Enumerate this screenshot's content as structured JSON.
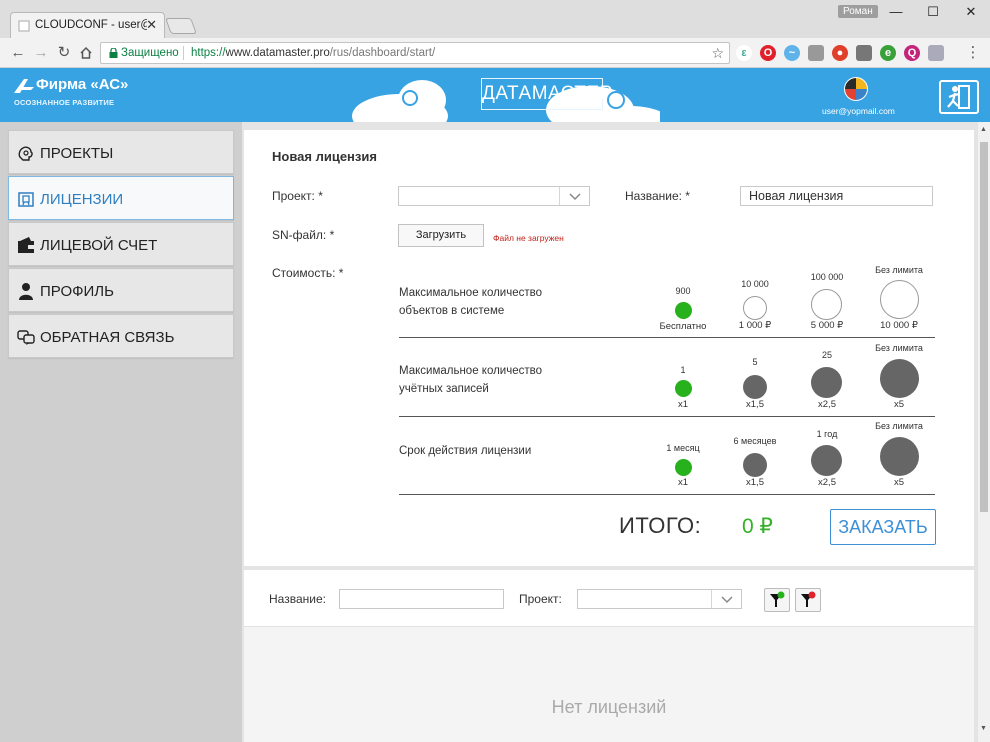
{
  "browser": {
    "tab_title": "CLOUDCONF - user@yop",
    "tab_close": "✕",
    "profile_name": "Роман",
    "window_controls": {
      "minimize": "—",
      "maximize": "☐",
      "close": "✕"
    },
    "secure_label": "Защищено",
    "url_scheme": "https://",
    "url_host": "www.datamaster.pro",
    "url_path": "/rus/dashboard/start/",
    "icons": [
      "back-icon",
      "forward-icon",
      "reload-icon",
      "home-icon",
      "lock-icon",
      "star-icon",
      "menu-icon"
    ]
  },
  "header": {
    "brand": "Фирма «АС»",
    "slogan": "ОСОЗНАННОЕ РАЗВИТИЕ",
    "product_logo": "ДАТАМАСТЕР",
    "user_email": "user@yopmail.com",
    "accent_color": "#37a3e3"
  },
  "sidebar": {
    "items": [
      {
        "label": "ПРОЕКТЫ",
        "icon": "brain-icon",
        "active": false
      },
      {
        "label": "ЛИЦЕНЗИИ",
        "icon": "license-icon",
        "active": true
      },
      {
        "label": "ЛИЦЕВОЙ СЧЕТ",
        "icon": "wallet-icon",
        "active": false
      },
      {
        "label": "ПРОФИЛЬ",
        "icon": "user-icon",
        "active": false
      },
      {
        "label": "ОБРАТНАЯ СВЯЗЬ",
        "icon": "chat-icon",
        "active": false
      }
    ]
  },
  "form": {
    "title": "Новая лицензия",
    "project_label": "Проект: *",
    "project_value": "",
    "name_label": "Название: *",
    "name_value": "Новая лицензия",
    "sn_label": "SN-файл: *",
    "upload_button": "Загрузить",
    "upload_status": "Файл не загружен",
    "cost_label": "Стоимость: *",
    "options": [
      {
        "desc_line1": "Максимальное количество",
        "desc_line2": "объектов в системе",
        "choices": [
          {
            "top": "900",
            "bottom": "Бесплатно",
            "selected": true
          },
          {
            "top": "10 000",
            "bottom": "1 000 ₽",
            "selected": false
          },
          {
            "top": "100 000",
            "bottom": "5 000 ₽",
            "selected": false
          },
          {
            "top": "Без лимита",
            "bottom": "10 000 ₽",
            "selected": false
          }
        ]
      },
      {
        "desc_line1": "Максимальное количество",
        "desc_line2": "учётных записей",
        "choices": [
          {
            "top": "1",
            "bottom": "x1",
            "selected": true
          },
          {
            "top": "5",
            "bottom": "x1,5",
            "selected": false
          },
          {
            "top": "25",
            "bottom": "x2,5",
            "selected": false
          },
          {
            "top": "Без лимита",
            "bottom": "x5",
            "selected": false
          }
        ]
      },
      {
        "desc_line1": "Срок действия лицензии",
        "desc_line2": "",
        "choices": [
          {
            "top": "1 месяц",
            "bottom": "x1",
            "selected": true
          },
          {
            "top": "6 месяцев",
            "bottom": "x1,5",
            "selected": false
          },
          {
            "top": "1 год",
            "bottom": "x2,5",
            "selected": false
          },
          {
            "top": "Без лимита",
            "bottom": "x5",
            "selected": false
          }
        ]
      }
    ],
    "total_label": "ИТОГО:",
    "total_value": "0 ₽",
    "order_button": "ЗАКАЗАТЬ"
  },
  "filter": {
    "name_label": "Название:",
    "name_value": "",
    "project_label": "Проект:",
    "project_value": "",
    "apply_icon": "filter-apply-icon",
    "reset_icon": "filter-reset-icon"
  },
  "list": {
    "empty_message": "Нет лицензий"
  }
}
